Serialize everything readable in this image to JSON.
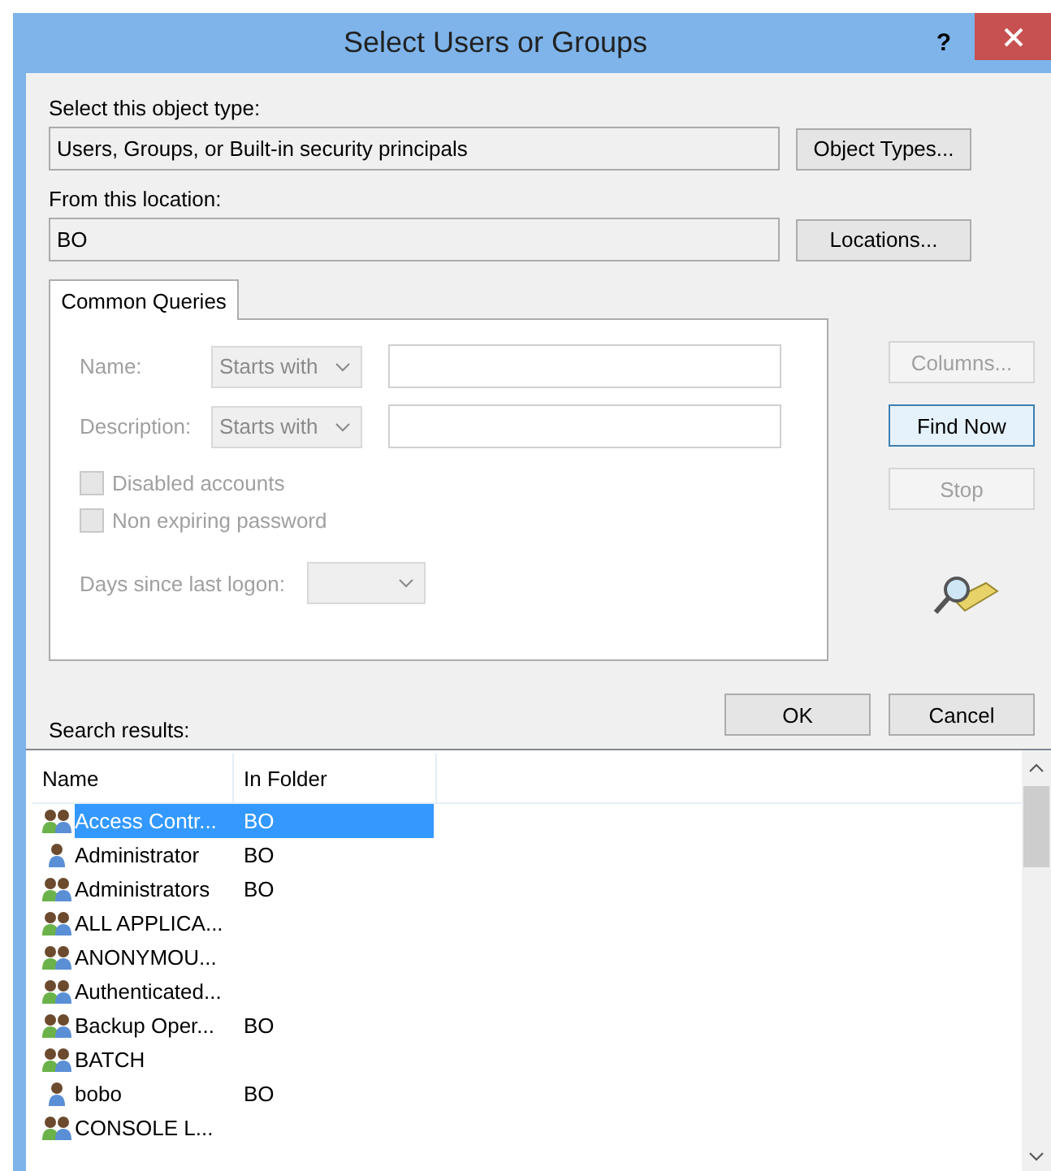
{
  "window": {
    "title": "Select Users or Groups",
    "help": "?"
  },
  "object_type": {
    "label": "Select this object type:",
    "value": "Users, Groups, or Built-in security principals",
    "button": "Object Types..."
  },
  "location": {
    "label": "From this location:",
    "value": "BO",
    "button": "Locations..."
  },
  "query_tab": {
    "label": "Common Queries",
    "selected": true
  },
  "query_fields": [
    {
      "label": "Name:",
      "condition": "Starts with",
      "disabled": true
    },
    {
      "label": "Description:",
      "condition": "Starts with",
      "disabled": true
    }
  ],
  "checkboxes": [
    {
      "label": "Disabled accounts",
      "checked": false,
      "disabled": true
    },
    {
      "label": "Non expiring password",
      "checked": false,
      "disabled": true
    }
  ],
  "days": {
    "label": "Days since last logon:",
    "disabled": true
  },
  "side_buttons": [
    {
      "label": "Columns...",
      "disabled": true,
      "default": false
    },
    {
      "label": "Find Now",
      "disabled": false,
      "default": true
    },
    {
      "label": "Stop",
      "disabled": true,
      "default": false
    }
  ],
  "dialog_buttons": [
    "OK",
    "Cancel"
  ],
  "results": {
    "label": "Search results:",
    "columns": [
      "Name",
      "In Folder"
    ],
    "rows": [
      {
        "name": "Access Contr...",
        "folder": "BO",
        "kind": "group",
        "selected": true
      },
      {
        "name": "Administrator",
        "folder": "BO",
        "kind": "user",
        "selected": false
      },
      {
        "name": "Administrators",
        "folder": "BO",
        "kind": "group",
        "selected": false
      },
      {
        "name": "ALL APPLICA...",
        "kind": "group",
        "selected": false
      },
      {
        "name": "ANONYMOU...",
        "kind": "group",
        "selected": false
      },
      {
        "name": "Authenticated...",
        "kind": "group",
        "selected": false
      },
      {
        "name": "Backup Oper...",
        "folder": "BO",
        "kind": "group",
        "selected": false
      },
      {
        "name": "BATCH",
        "kind": "group",
        "selected": false
      },
      {
        "name": "bobo",
        "folder": "BO",
        "kind": "user",
        "selected": false
      },
      {
        "name": "CONSOLE L...",
        "kind": "group",
        "selected": false
      }
    ]
  }
}
